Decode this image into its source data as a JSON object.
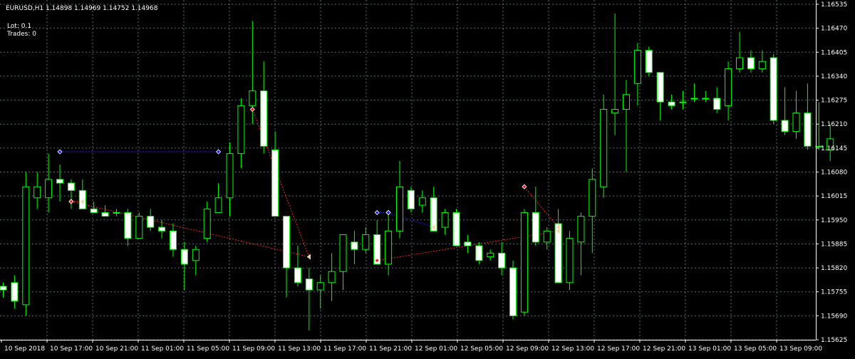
{
  "header": {
    "symbol_info": "EURUSD,H1  1.14898 1.14969 1.14752 1.14968",
    "lot_label": "Lot: 0.1",
    "trades_label": "Trades: 0"
  },
  "colors": {
    "background": "#000000",
    "grid": "#596b6b",
    "axis_text": "#ffffff",
    "candle_outline": "#00ff00",
    "bull_body": "#000000",
    "bear_body": "#ffffff",
    "buy_marker": "#1a1aff",
    "sell_marker": "#ff1a1a",
    "close_marker": "#f0d8a0",
    "buy_line": "#2020ff",
    "sell_line": "#ff2020"
  },
  "chart_data": {
    "type": "candlestick",
    "symbol": "EURUSD",
    "timeframe": "H1",
    "y_ticks": [
      "1.16535",
      "1.16470",
      "1.16405",
      "1.16340",
      "1.16275",
      "1.16210",
      "1.16145",
      "1.16080",
      "1.16015",
      "1.15950",
      "1.15885",
      "1.15820",
      "1.15755",
      "1.15690",
      "1.15625"
    ],
    "x_labels": [
      "10 Sep 2018",
      "10 Sep 17:00",
      "10 Sep 21:00",
      "11 Sep 01:00",
      "11 Sep 05:00",
      "11 Sep 09:00",
      "11 Sep 13:00",
      "11 Sep 17:00",
      "11 Sep 21:00",
      "12 Sep 01:00",
      "12 Sep 05:00",
      "12 Sep 09:00",
      "12 Sep 13:00",
      "12 Sep 17:00",
      "12 Sep 21:00",
      "13 Sep 01:00",
      "13 Sep 05:00",
      "13 Sep 09:00"
    ],
    "ylim": [
      1.15625,
      1.16535
    ],
    "candles": [
      {
        "o": 1.1577,
        "h": 1.1578,
        "l": 1.1574,
        "c": 1.1576
      },
      {
        "o": 1.1578,
        "h": 1.158,
        "l": 1.1571,
        "c": 1.1573
      },
      {
        "o": 1.1572,
        "h": 1.1608,
        "l": 1.1569,
        "c": 1.1604
      },
      {
        "o": 1.1601,
        "h": 1.1608,
        "l": 1.1598,
        "c": 1.1604
      },
      {
        "o": 1.1601,
        "h": 1.1613,
        "l": 1.1597,
        "c": 1.1606
      },
      {
        "o": 1.1606,
        "h": 1.161,
        "l": 1.16,
        "c": 1.1605
      },
      {
        "o": 1.1605,
        "h": 1.1606,
        "l": 1.1598,
        "c": 1.1603
      },
      {
        "o": 1.1603,
        "h": 1.1606,
        "l": 1.1598,
        "c": 1.1598
      },
      {
        "o": 1.1598,
        "h": 1.16,
        "l": 1.1597,
        "c": 1.1597
      },
      {
        "o": 1.1597,
        "h": 1.1599,
        "l": 1.1596,
        "c": 1.1596
      },
      {
        "o": 1.1597,
        "h": 1.1598,
        "l": 1.1596,
        "c": 1.1597
      },
      {
        "o": 1.1597,
        "h": 1.1598,
        "l": 1.1588,
        "c": 1.159
      },
      {
        "o": 1.159,
        "h": 1.1597,
        "l": 1.159,
        "c": 1.1596
      },
      {
        "o": 1.1596,
        "h": 1.1598,
        "l": 1.1592,
        "c": 1.1593
      },
      {
        "o": 1.1593,
        "h": 1.1595,
        "l": 1.159,
        "c": 1.1592
      },
      {
        "o": 1.1592,
        "h": 1.1594,
        "l": 1.1585,
        "c": 1.1587
      },
      {
        "o": 1.1587,
        "h": 1.1589,
        "l": 1.1576,
        "c": 1.1583
      },
      {
        "o": 1.1584,
        "h": 1.1588,
        "l": 1.158,
        "c": 1.1587
      },
      {
        "o": 1.159,
        "h": 1.16,
        "l": 1.1589,
        "c": 1.1598
      },
      {
        "o": 1.1597,
        "h": 1.1605,
        "l": 1.1597,
        "c": 1.1601
      },
      {
        "o": 1.1601,
        "h": 1.1616,
        "l": 1.1596,
        "c": 1.1613
      },
      {
        "o": 1.1613,
        "h": 1.1628,
        "l": 1.1609,
        "c": 1.1626
      },
      {
        "o": 1.1626,
        "h": 1.1649,
        "l": 1.1621,
        "c": 1.163
      },
      {
        "o": 1.163,
        "h": 1.1638,
        "l": 1.1613,
        "c": 1.1615
      },
      {
        "o": 1.1614,
        "h": 1.1619,
        "l": 1.1596,
        "c": 1.1596
      },
      {
        "o": 1.1596,
        "h": 1.1596,
        "l": 1.1574,
        "c": 1.1582
      },
      {
        "o": 1.1582,
        "h": 1.1588,
        "l": 1.1577,
        "c": 1.1578
      },
      {
        "o": 1.1579,
        "h": 1.1582,
        "l": 1.1565,
        "c": 1.1576
      },
      {
        "o": 1.1576,
        "h": 1.158,
        "l": 1.1571,
        "c": 1.1578
      },
      {
        "o": 1.1578,
        "h": 1.1586,
        "l": 1.1573,
        "c": 1.1581
      },
      {
        "o": 1.1581,
        "h": 1.1591,
        "l": 1.1576,
        "c": 1.1591
      },
      {
        "o": 1.1589,
        "h": 1.1592,
        "l": 1.1583,
        "c": 1.1587
      },
      {
        "o": 1.1587,
        "h": 1.1593,
        "l": 1.1586,
        "c": 1.1591
      },
      {
        "o": 1.1591,
        "h": 1.1595,
        "l": 1.1583,
        "c": 1.1583
      },
      {
        "o": 1.1583,
        "h": 1.1597,
        "l": 1.158,
        "c": 1.1592
      },
      {
        "o": 1.1592,
        "h": 1.1611,
        "l": 1.159,
        "c": 1.1604
      },
      {
        "o": 1.1603,
        "h": 1.1604,
        "l": 1.1597,
        "c": 1.1598
      },
      {
        "o": 1.1599,
        "h": 1.1603,
        "l": 1.1597,
        "c": 1.1601
      },
      {
        "o": 1.1601,
        "h": 1.1604,
        "l": 1.1592,
        "c": 1.1592
      },
      {
        "o": 1.1593,
        "h": 1.1598,
        "l": 1.1591,
        "c": 1.1597
      },
      {
        "o": 1.1597,
        "h": 1.1598,
        "l": 1.1588,
        "c": 1.1588
      },
      {
        "o": 1.1589,
        "h": 1.1591,
        "l": 1.1586,
        "c": 1.1588
      },
      {
        "o": 1.1588,
        "h": 1.1589,
        "l": 1.1583,
        "c": 1.1584
      },
      {
        "o": 1.1585,
        "h": 1.1587,
        "l": 1.1584,
        "c": 1.1586
      },
      {
        "o": 1.1586,
        "h": 1.1589,
        "l": 1.158,
        "c": 1.1582
      },
      {
        "o": 1.1582,
        "h": 1.1584,
        "l": 1.1568,
        "c": 1.1569
      },
      {
        "o": 1.157,
        "h": 1.1598,
        "l": 1.1569,
        "c": 1.1597
      },
      {
        "o": 1.1597,
        "h": 1.1604,
        "l": 1.1588,
        "c": 1.1589
      },
      {
        "o": 1.1589,
        "h": 1.1593,
        "l": 1.1587,
        "c": 1.1592
      },
      {
        "o": 1.1594,
        "h": 1.1598,
        "l": 1.1578,
        "c": 1.1578
      },
      {
        "o": 1.1578,
        "h": 1.1592,
        "l": 1.1576,
        "c": 1.159
      },
      {
        "o": 1.1589,
        "h": 1.1597,
        "l": 1.158,
        "c": 1.1596
      },
      {
        "o": 1.1596,
        "h": 1.1609,
        "l": 1.1586,
        "c": 1.1606
      },
      {
        "o": 1.1604,
        "h": 1.1629,
        "l": 1.1601,
        "c": 1.1625
      },
      {
        "o": 1.1624,
        "h": 1.1651,
        "l": 1.1618,
        "c": 1.1625
      },
      {
        "o": 1.1625,
        "h": 1.1633,
        "l": 1.1608,
        "c": 1.1629
      },
      {
        "o": 1.1632,
        "h": 1.1643,
        "l": 1.1626,
        "c": 1.1641
      },
      {
        "o": 1.1641,
        "h": 1.1642,
        "l": 1.1634,
        "c": 1.1635
      },
      {
        "o": 1.1635,
        "h": 1.1635,
        "l": 1.1622,
        "c": 1.1627
      },
      {
        "o": 1.1627,
        "h": 1.1629,
        "l": 1.1625,
        "c": 1.1626
      },
      {
        "o": 1.1627,
        "h": 1.163,
        "l": 1.1625,
        "c": 1.1627
      },
      {
        "o": 1.1628,
        "h": 1.1632,
        "l": 1.1627,
        "c": 1.1628
      },
      {
        "o": 1.1628,
        "h": 1.163,
        "l": 1.1627,
        "c": 1.1628
      },
      {
        "o": 1.1628,
        "h": 1.1631,
        "l": 1.1624,
        "c": 1.1625
      },
      {
        "o": 1.1626,
        "h": 1.1638,
        "l": 1.1622,
        "c": 1.1636
      },
      {
        "o": 1.1636,
        "h": 1.1646,
        "l": 1.1635,
        "c": 1.1639
      },
      {
        "o": 1.1639,
        "h": 1.1641,
        "l": 1.1635,
        "c": 1.1636
      },
      {
        "o": 1.1636,
        "h": 1.1641,
        "l": 1.1635,
        "c": 1.1638
      },
      {
        "o": 1.1639,
        "h": 1.164,
        "l": 1.1621,
        "c": 1.1622
      },
      {
        "o": 1.1622,
        "h": 1.1631,
        "l": 1.1618,
        "c": 1.1619
      },
      {
        "o": 1.1619,
        "h": 1.163,
        "l": 1.1617,
        "c": 1.1624
      },
      {
        "o": 1.1624,
        "h": 1.1632,
        "l": 1.1614,
        "c": 1.1615
      },
      {
        "o": 1.1615,
        "h": 1.1627,
        "l": 1.1614,
        "c": 1.1615
      },
      {
        "o": 1.1614,
        "h": 1.1621,
        "l": 1.1611,
        "c": 1.1617
      }
    ]
  },
  "trades": [
    {
      "type": "buy",
      "open_bar": 5,
      "open_price": 1.16135,
      "close_bar": 19,
      "close_price": 1.16135
    },
    {
      "type": "sell",
      "open_bar": 6,
      "open_price": 1.16,
      "close_bar": 7,
      "close_price": 1.16
    },
    {
      "type": "sell",
      "open_bar": 6,
      "open_price": 1.16,
      "close_bar": 27,
      "close_price": 1.1585
    },
    {
      "type": "sell",
      "open_bar": 22,
      "open_price": 1.1625,
      "close_bar": 27,
      "close_price": 1.1585
    },
    {
      "type": "buy",
      "open_bar": 33,
      "open_price": 1.1597,
      "close_bar": 34,
      "close_price": 1.1597
    },
    {
      "type": "buy",
      "open_bar": 34,
      "open_price": 1.1597,
      "close_bar": 38,
      "close_price": 1.1593
    },
    {
      "type": "sell",
      "open_bar": 33,
      "open_price": 1.1584,
      "close_bar": 49,
      "close_price": 1.1592
    },
    {
      "type": "sell",
      "open_bar": 46,
      "open_price": 1.1604,
      "close_bar": 49,
      "close_price": 1.1593
    }
  ]
}
